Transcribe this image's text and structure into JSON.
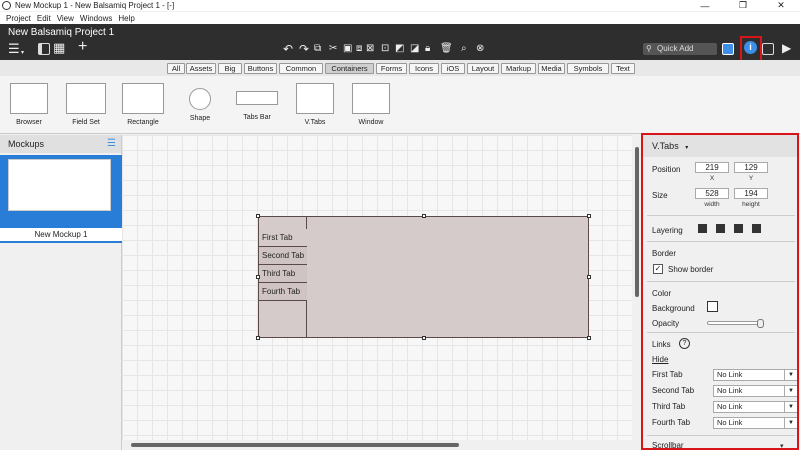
{
  "window": {
    "title": "New Mockup 1 - New Balsamiq Project 1 - [-]"
  },
  "menu": [
    "Project",
    "Edit",
    "View",
    "Windows",
    "Help"
  ],
  "app": {
    "project_title": "New Balsamiq Project 1",
    "quick_add_placeholder": "Quick Add"
  },
  "filters": {
    "tabs": [
      "All",
      "Assets",
      "Big",
      "Buttons",
      "Common",
      "Containers",
      "Forms",
      "Icons",
      "iOS",
      "Layout",
      "Markup",
      "Media",
      "Symbols",
      "Text"
    ],
    "active": "Containers"
  },
  "gallery": [
    "Browser",
    "Field Set",
    "Rectangle",
    "Shape",
    "Tabs Bar",
    "V.Tabs",
    "Window"
  ],
  "left_panel": {
    "header": "Mockups",
    "mockup_name": "New Mockup 1"
  },
  "canvas": {
    "tabs": [
      "First Tab",
      "Second Tab",
      "Third Tab",
      "Fourth Tab"
    ]
  },
  "inspector": {
    "title": "V.Tabs",
    "position_label": "Position",
    "x": "219",
    "y": "129",
    "x_caption": "X",
    "y_caption": "Y",
    "size_label": "Size",
    "width": "528",
    "height": "194",
    "width_caption": "width",
    "height_caption": "height",
    "layering_label": "Layering",
    "border_label": "Border",
    "show_border_label": "Show border",
    "color_label": "Color",
    "background_label": "Background",
    "opacity_label": "Opacity",
    "opacity": 0.95,
    "links_label": "Links",
    "hide_label": "Hide",
    "link_rows": [
      {
        "tab": "First Tab",
        "value": "No Link"
      },
      {
        "tab": "Second Tab",
        "value": "No Link"
      },
      {
        "tab": "Third Tab",
        "value": "No Link"
      },
      {
        "tab": "Fourth Tab",
        "value": "No Link"
      }
    ],
    "scrollbar_label": "Scrollbar"
  },
  "colors": {
    "accent": "#2a7dd6",
    "highlight": "#d9151a",
    "tabs_fill": "#d6cbcb"
  }
}
